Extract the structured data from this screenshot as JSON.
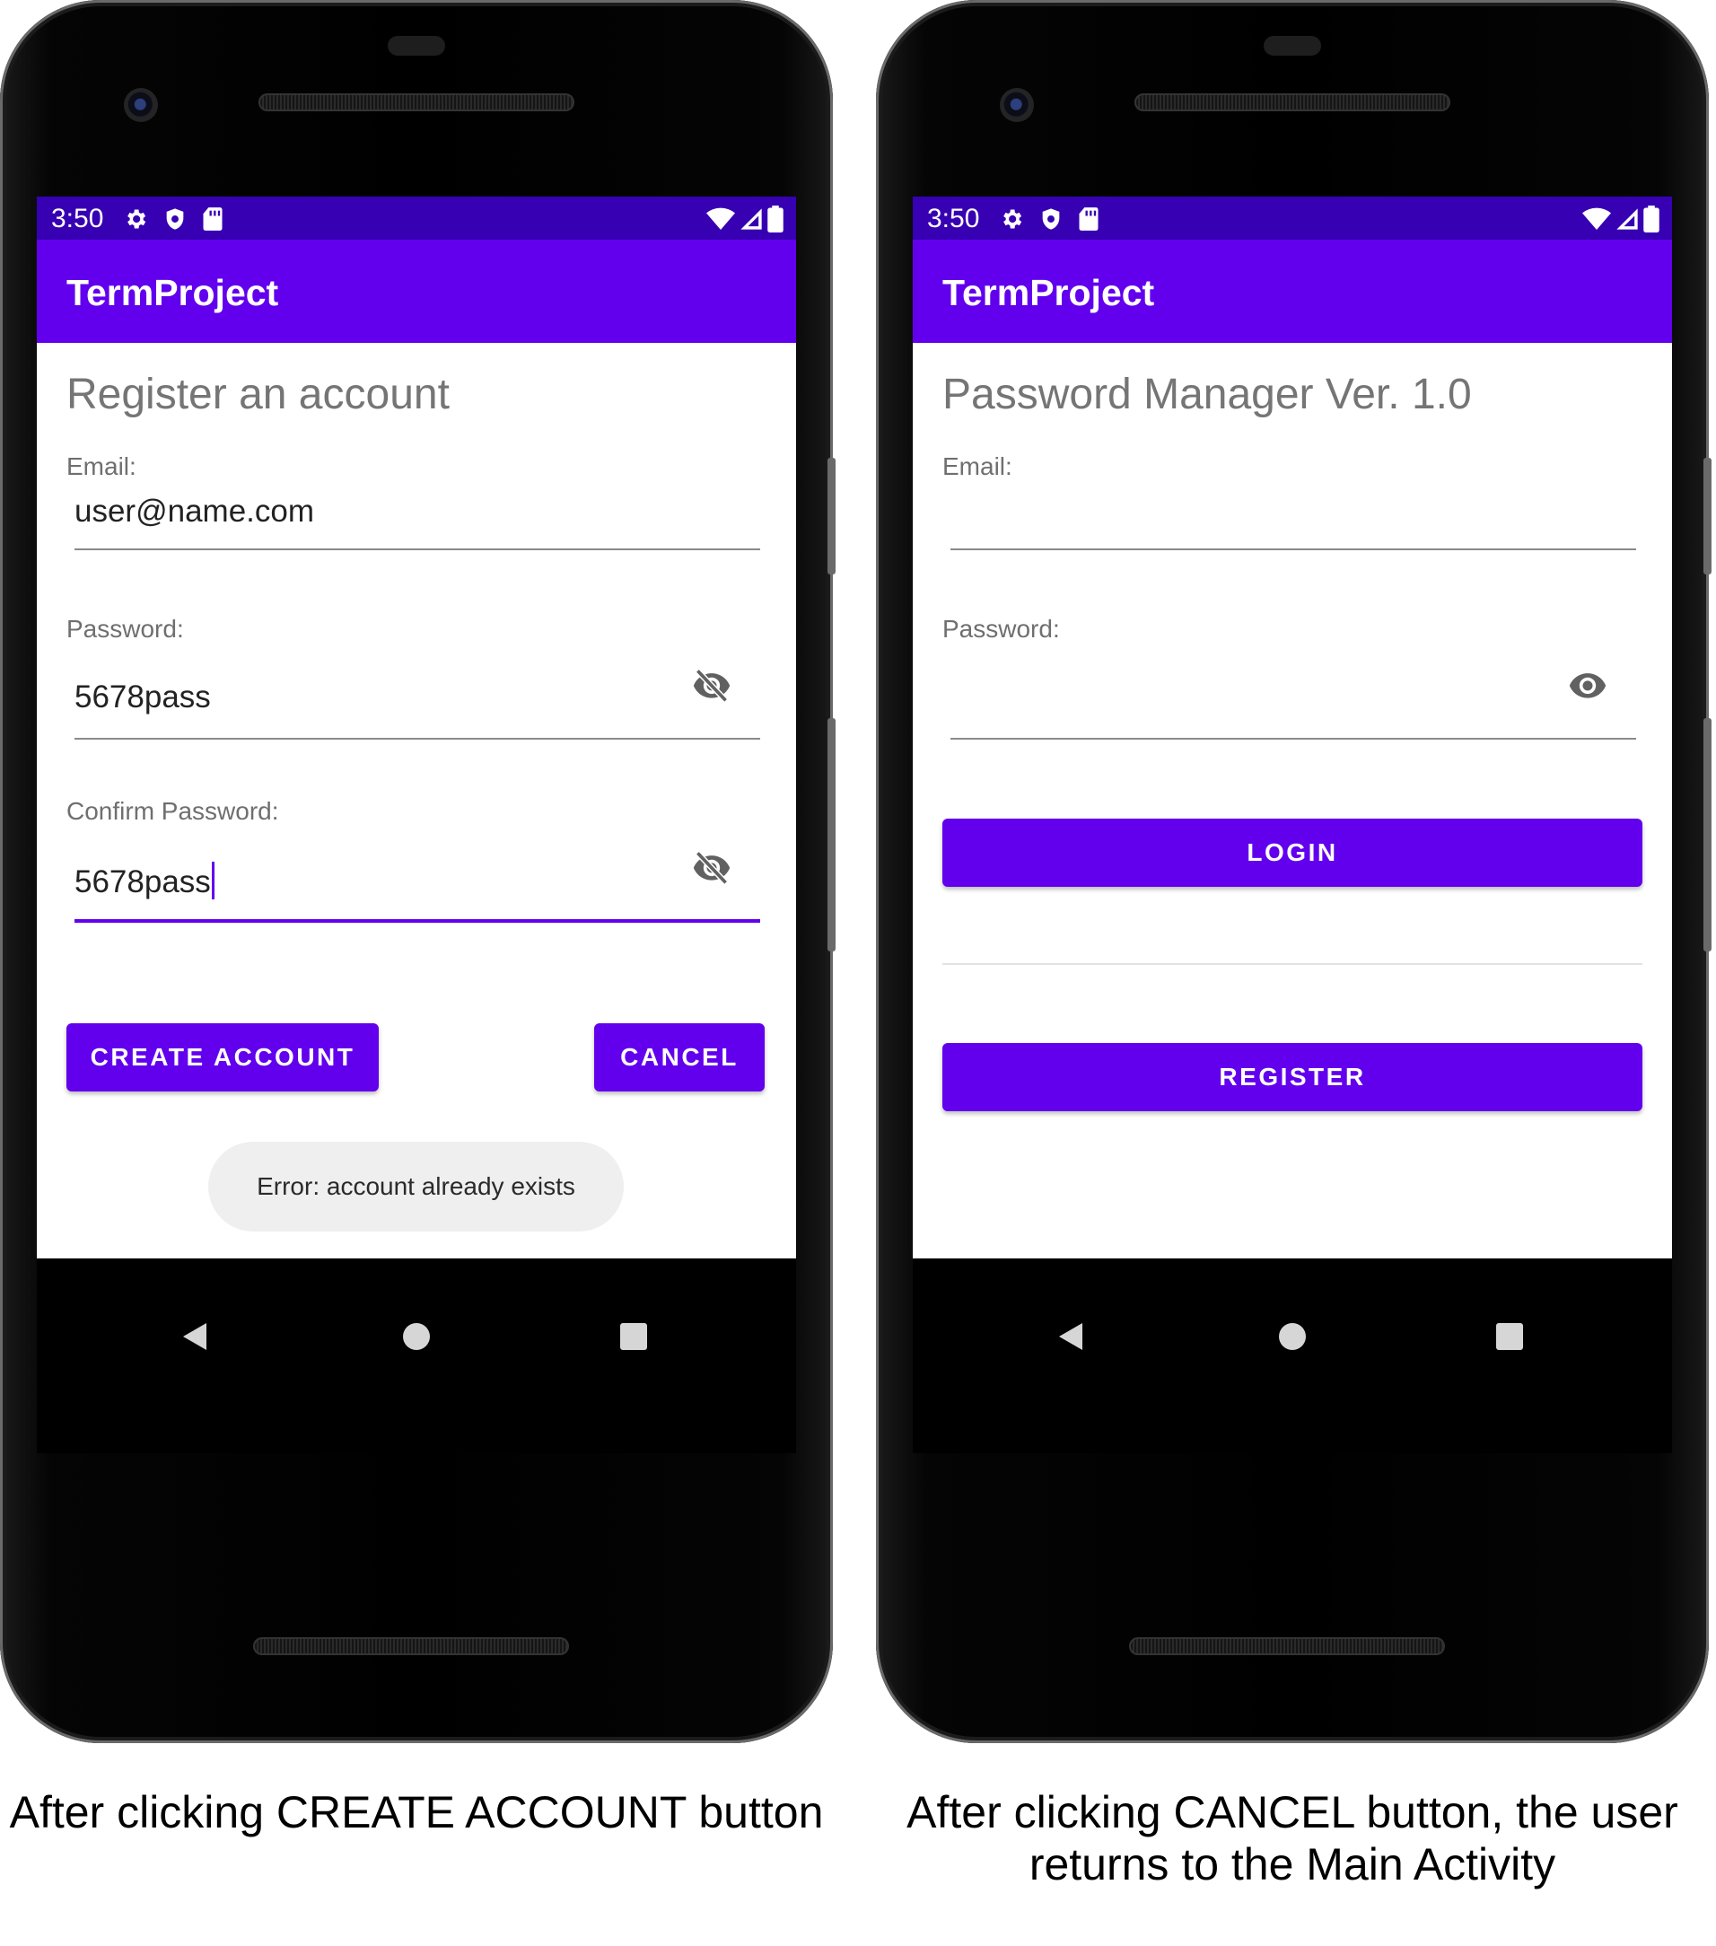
{
  "phones": [
    {
      "status_time": "3:50",
      "app_title": "TermProject",
      "heading": "Register an account",
      "email_label": "Email:",
      "email_value": "user@name.com",
      "password_label": "Password:",
      "password_value": "5678pass",
      "confirm_label": "Confirm Password:",
      "confirm_value": "5678pass",
      "create_button": "CREATE ACCOUNT",
      "cancel_button": "CANCEL",
      "toast": "Error: account already exists",
      "caption": "After clicking CREATE ACCOUNT button"
    },
    {
      "status_time": "3:50",
      "app_title": "TermProject",
      "heading": "Password Manager Ver. 1.0",
      "email_label": "Email:",
      "email_value": "",
      "password_label": "Password:",
      "password_value": "",
      "login_button": "LOGIN",
      "register_button": "REGISTER",
      "caption_line1": "After clicking CANCEL button, the user",
      "caption_line2": "returns to the Main Activity"
    }
  ],
  "colors": {
    "status_bar": "#3700b3",
    "app_bar": "#6200ee",
    "accent": "#6200ee"
  },
  "icons": {
    "status": [
      "settings-icon",
      "shield-icon",
      "sd-card-icon",
      "wifi-icon",
      "cell-signal-icon",
      "battery-icon"
    ],
    "password_toggle_left": "eye-off-icon",
    "password_toggle_right": "eye-icon",
    "nav": [
      "back-icon",
      "home-icon",
      "recents-icon"
    ]
  }
}
